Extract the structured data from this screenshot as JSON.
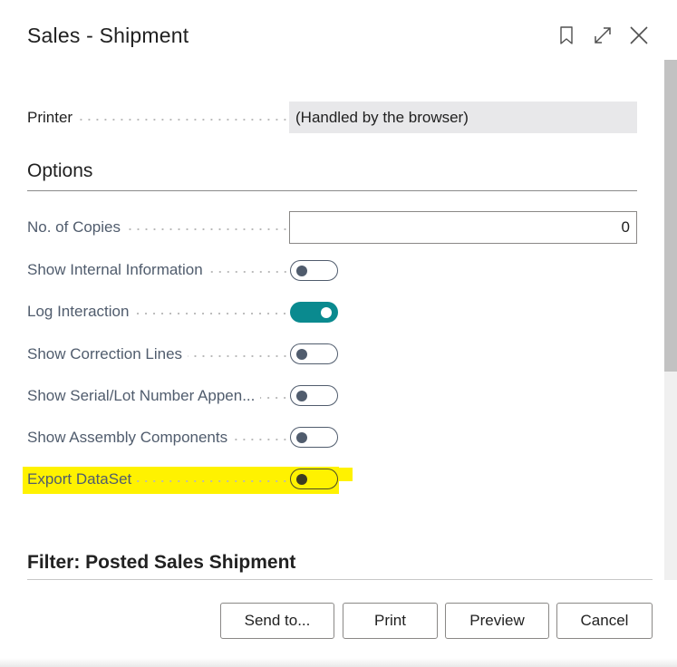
{
  "dialog": {
    "title": "Sales - Shipment"
  },
  "printer": {
    "label": "Printer",
    "value": "(Handled by the browser)"
  },
  "options": {
    "header": "Options",
    "no_of_copies": {
      "label": "No. of Copies",
      "value": "0"
    },
    "toggles": [
      {
        "label": "Show Internal Information",
        "on": false
      },
      {
        "label": "Log Interaction",
        "on": true
      },
      {
        "label": "Show Correction Lines",
        "on": false
      },
      {
        "label": "Show Serial/Lot Number Appen...",
        "on": false
      },
      {
        "label": "Show Assembly Components",
        "on": false
      },
      {
        "label": "Export DataSet",
        "on": false
      }
    ]
  },
  "filter": {
    "header": "Filter: Posted Sales Shipment"
  },
  "buttons": {
    "send_to": "Send to...",
    "print": "Print",
    "preview": "Preview",
    "cancel": "Cancel"
  },
  "icons": {
    "bookmark": "bookmark-icon",
    "expand": "expand-icon",
    "close": "close-icon"
  },
  "colors": {
    "toggle_on": "#0a8a8f",
    "highlight": "#fff200",
    "label_text": "#505c6d"
  }
}
